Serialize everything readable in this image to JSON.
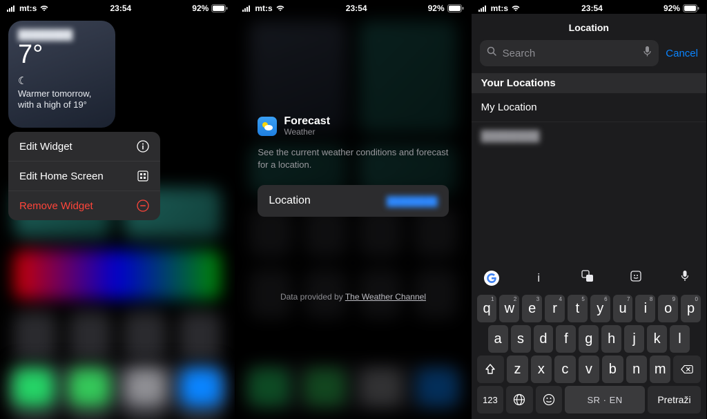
{
  "status": {
    "carrier": "mt:s",
    "time": "23:54",
    "battery_pct": "92%"
  },
  "screen1": {
    "widget": {
      "temperature": "7°",
      "description": "Warmer tomorrow, with a high of 19°"
    },
    "menu": {
      "edit_widget": "Edit Widget",
      "edit_home": "Edit Home Screen",
      "remove": "Remove Widget"
    }
  },
  "screen2": {
    "header_title": "Forecast",
    "header_sub": "Weather",
    "description": "See the current weather conditions and forecast for a location.",
    "location_label": "Location",
    "footer_prefix": "Data provided by ",
    "footer_link": "The Weather Channel"
  },
  "screen3": {
    "title": "Location",
    "search_placeholder": "Search",
    "cancel": "Cancel",
    "section": "Your Locations",
    "items": {
      "my_location": "My Location"
    }
  },
  "keyboard": {
    "suggestion": "i",
    "row1": [
      "q",
      "w",
      "e",
      "r",
      "t",
      "y",
      "u",
      "i",
      "o",
      "p"
    ],
    "row1_nums": [
      "1",
      "2",
      "3",
      "4",
      "5",
      "6",
      "7",
      "8",
      "9",
      "0"
    ],
    "row2": [
      "a",
      "s",
      "d",
      "f",
      "g",
      "h",
      "j",
      "k",
      "l"
    ],
    "row3": [
      "z",
      "x",
      "c",
      "v",
      "b",
      "n",
      "m"
    ],
    "num_key": "123",
    "space_label": "SR · EN",
    "search_label": "Pretraži"
  }
}
